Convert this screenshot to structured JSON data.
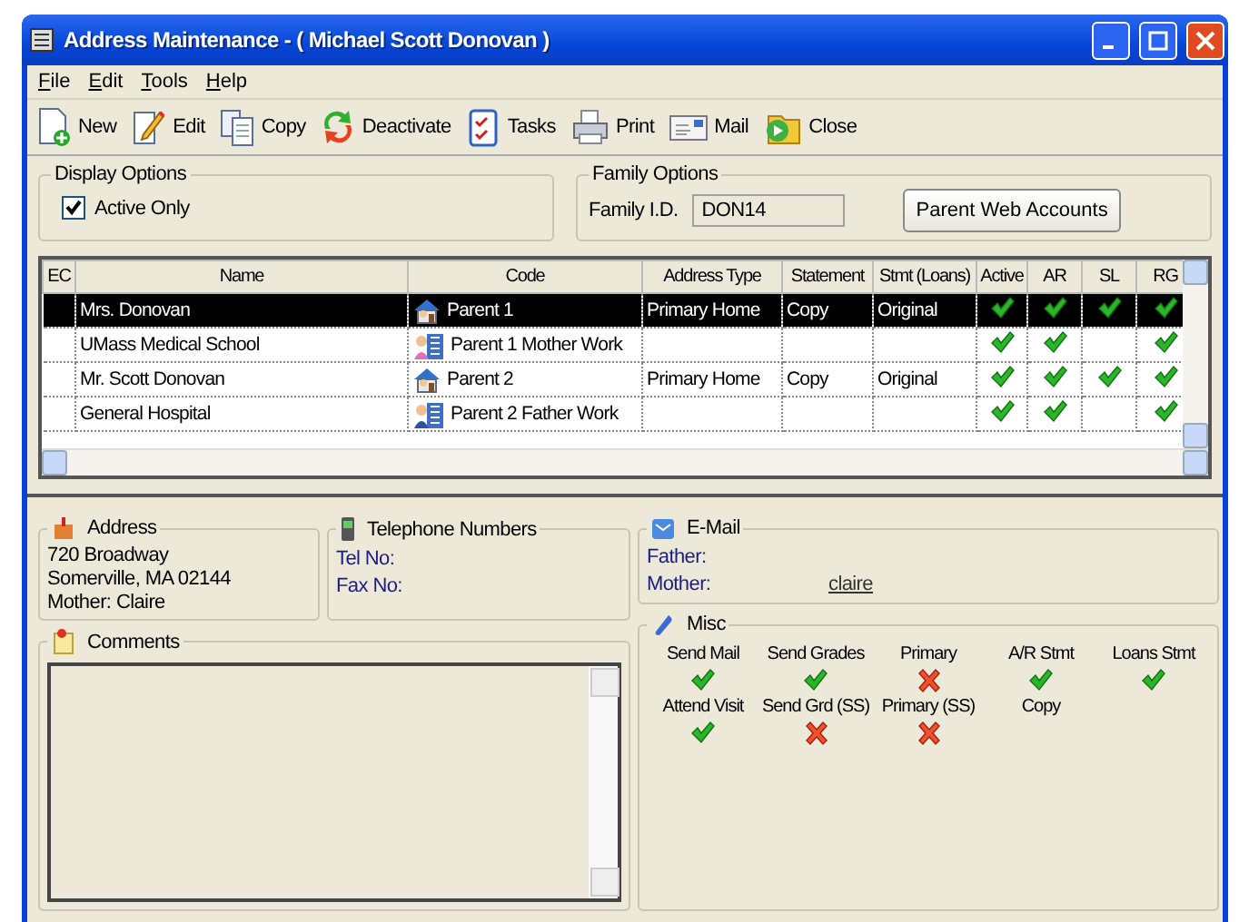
{
  "window": {
    "title": "Address Maintenance - ( Michael Scott Donovan )"
  },
  "menu": [
    "File",
    "Edit",
    "Tools",
    "Help"
  ],
  "toolbar": [
    {
      "kind": "new",
      "label": "New"
    },
    {
      "kind": "edit",
      "label": "Edit"
    },
    {
      "kind": "copy",
      "label": "Copy"
    },
    {
      "kind": "deactivate",
      "label": "Deactivate"
    },
    {
      "kind": "tasks",
      "label": "Tasks"
    },
    {
      "kind": "print",
      "label": "Print"
    },
    {
      "kind": "mail",
      "label": "Mail"
    },
    {
      "kind": "close",
      "label": "Close"
    }
  ],
  "display_options": {
    "title": "Display Options",
    "active_only": {
      "label": "Active Only",
      "checked": true
    }
  },
  "family_options": {
    "title": "Family Options",
    "family_id_label": "Family I.D.",
    "family_id": "DON14",
    "button": "Parent Web Accounts"
  },
  "table": {
    "columns": [
      "EC",
      "Name",
      "Code",
      "Address Type",
      "Statement",
      "Stmt (Loans)",
      "Active",
      "AR",
      "SL",
      "RG"
    ],
    "rows": [
      {
        "selected": true,
        "name": "Mrs. Donovan",
        "kind": "home",
        "code": "Parent 1",
        "address_type": "Primary Home",
        "statement": "Copy",
        "stmt_loans": "Original",
        "active": true,
        "ar": true,
        "sl": true,
        "rg": true
      },
      {
        "selected": false,
        "name": "UMass Medical School",
        "kind": "work_female",
        "code": "Parent 1 Mother Work",
        "active": true,
        "ar": true,
        "sl": false,
        "rg": true
      },
      {
        "selected": false,
        "name": "Mr. Scott Donovan",
        "kind": "home",
        "code": "Parent 2",
        "address_type": "Primary Home",
        "statement": "Copy",
        "stmt_loans": "Original",
        "active": true,
        "ar": true,
        "sl": true,
        "rg": true
      },
      {
        "selected": false,
        "name": "General Hospital",
        "kind": "work_male",
        "code": "Parent 2 Father Work",
        "active": true,
        "ar": true,
        "sl": false,
        "rg": true
      }
    ]
  },
  "address": {
    "title": "Address",
    "lines": [
      "720 Broadway",
      "Somerville, MA 02144",
      "Mother: Claire"
    ]
  },
  "telephone": {
    "title": "Telephone Numbers",
    "fields": [
      {
        "label": "Tel No:"
      },
      {
        "label": "Fax No:"
      }
    ]
  },
  "email": {
    "title": "E-Mail",
    "fields": [
      {
        "label": "Father:"
      },
      {
        "label": "Mother:",
        "value": "claire"
      }
    ]
  },
  "misc": {
    "title": "Misc",
    "items": [
      {
        "label": "Send Mail",
        "kind": "flag",
        "on": true
      },
      {
        "label": "Send Grades",
        "kind": "flag",
        "on": true
      },
      {
        "label": "Primary",
        "kind": "flag",
        "on": false
      },
      {
        "label": "A/R Stmt",
        "kind": "flag",
        "on": true
      },
      {
        "label": "Loans Stmt",
        "kind": "flag",
        "on": true
      },
      {
        "label": "Attend Visit",
        "kind": "flag",
        "on": true
      },
      {
        "label": "Send Grd (SS)",
        "kind": "flag",
        "on": false
      },
      {
        "label": "Primary (SS)",
        "kind": "flag",
        "on": false
      },
      {
        "label": "Copy",
        "kind": "text"
      }
    ]
  },
  "comments": {
    "title": "Comments"
  }
}
